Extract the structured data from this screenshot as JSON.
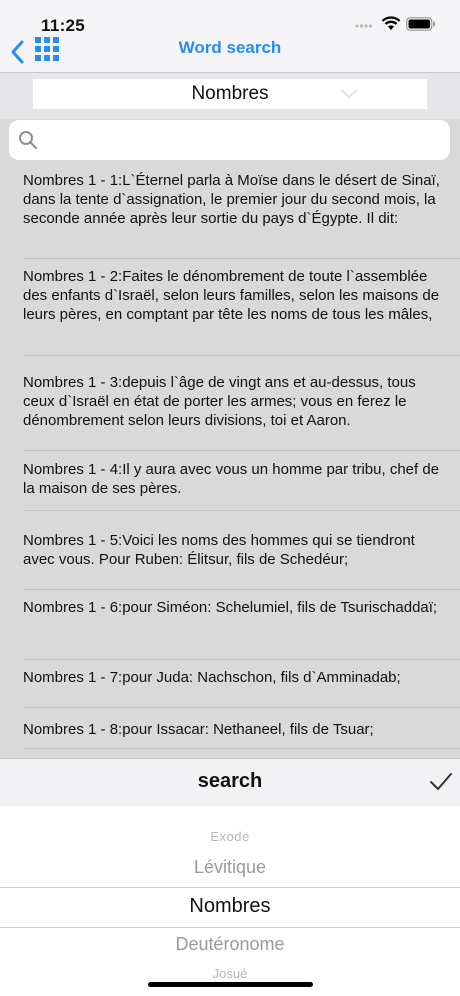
{
  "status": {
    "time": "11:25"
  },
  "nav": {
    "title": "Word search"
  },
  "book": {
    "selected": "Nombres"
  },
  "search": {
    "placeholder": "",
    "value": ""
  },
  "verses": [
    "Nombres 1 - 1:L`Éternel parla à Moïse dans le désert de Sinaï, dans la tente d`assignation, le premier jour du second mois, la seconde année après leur sortie du pays d`Égypte. Il dit:",
    "Nombres 1 - 2:Faites le dénombrement de toute l`assemblée des enfants d`Israël, selon leurs familles, selon les maisons de leurs pères, en comptant par tête les noms de tous les mâles,",
    "Nombres 1 - 3:depuis l`âge de vingt ans et au-dessus, tous ceux d`Israël en état de porter les armes; vous en ferez le dénombrement selon leurs divisions, toi et Aaron.",
    "Nombres 1 - 4:Il y aura avec vous un homme par tribu, chef de la maison de ses pères.",
    "Nombres 1 - 5:Voici les noms des hommes qui se tiendront avec vous. Pour Ruben: Élitsur, fils de Schedéur;",
    "Nombres 1 - 6:pour Siméon: Schelumiel, fils de Tsurischaddaï;",
    "Nombres 1 - 7:pour Juda: Nachschon, fils d`Amminadab;",
    "Nombres 1 - 8:pour Issacar: Nethaneel, fils de Tsuar;"
  ],
  "toolbar": {
    "title": "search"
  },
  "picker": {
    "options": [
      "Exode",
      "Lévitique",
      "Nombres",
      "Deutéronome",
      "Josué"
    ]
  }
}
